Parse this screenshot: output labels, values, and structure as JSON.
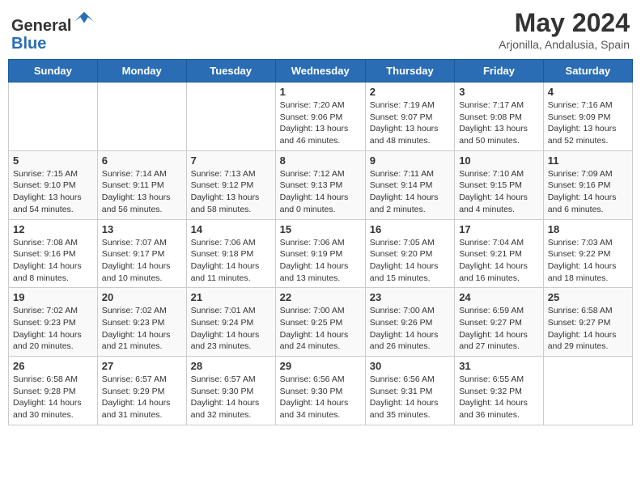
{
  "header": {
    "logo_line1": "General",
    "logo_line2": "Blue",
    "month_year": "May 2024",
    "location": "Arjonilla, Andalusia, Spain"
  },
  "days_of_week": [
    "Sunday",
    "Monday",
    "Tuesday",
    "Wednesday",
    "Thursday",
    "Friday",
    "Saturday"
  ],
  "weeks": [
    [
      {
        "day": "",
        "info": ""
      },
      {
        "day": "",
        "info": ""
      },
      {
        "day": "",
        "info": ""
      },
      {
        "day": "1",
        "info": "Sunrise: 7:20 AM\nSunset: 9:06 PM\nDaylight: 13 hours\nand 46 minutes."
      },
      {
        "day": "2",
        "info": "Sunrise: 7:19 AM\nSunset: 9:07 PM\nDaylight: 13 hours\nand 48 minutes."
      },
      {
        "day": "3",
        "info": "Sunrise: 7:17 AM\nSunset: 9:08 PM\nDaylight: 13 hours\nand 50 minutes."
      },
      {
        "day": "4",
        "info": "Sunrise: 7:16 AM\nSunset: 9:09 PM\nDaylight: 13 hours\nand 52 minutes."
      }
    ],
    [
      {
        "day": "5",
        "info": "Sunrise: 7:15 AM\nSunset: 9:10 PM\nDaylight: 13 hours\nand 54 minutes."
      },
      {
        "day": "6",
        "info": "Sunrise: 7:14 AM\nSunset: 9:11 PM\nDaylight: 13 hours\nand 56 minutes."
      },
      {
        "day": "7",
        "info": "Sunrise: 7:13 AM\nSunset: 9:12 PM\nDaylight: 13 hours\nand 58 minutes."
      },
      {
        "day": "8",
        "info": "Sunrise: 7:12 AM\nSunset: 9:13 PM\nDaylight: 14 hours\nand 0 minutes."
      },
      {
        "day": "9",
        "info": "Sunrise: 7:11 AM\nSunset: 9:14 PM\nDaylight: 14 hours\nand 2 minutes."
      },
      {
        "day": "10",
        "info": "Sunrise: 7:10 AM\nSunset: 9:15 PM\nDaylight: 14 hours\nand 4 minutes."
      },
      {
        "day": "11",
        "info": "Sunrise: 7:09 AM\nSunset: 9:16 PM\nDaylight: 14 hours\nand 6 minutes."
      }
    ],
    [
      {
        "day": "12",
        "info": "Sunrise: 7:08 AM\nSunset: 9:16 PM\nDaylight: 14 hours\nand 8 minutes."
      },
      {
        "day": "13",
        "info": "Sunrise: 7:07 AM\nSunset: 9:17 PM\nDaylight: 14 hours\nand 10 minutes."
      },
      {
        "day": "14",
        "info": "Sunrise: 7:06 AM\nSunset: 9:18 PM\nDaylight: 14 hours\nand 11 minutes."
      },
      {
        "day": "15",
        "info": "Sunrise: 7:06 AM\nSunset: 9:19 PM\nDaylight: 14 hours\nand 13 minutes."
      },
      {
        "day": "16",
        "info": "Sunrise: 7:05 AM\nSunset: 9:20 PM\nDaylight: 14 hours\nand 15 minutes."
      },
      {
        "day": "17",
        "info": "Sunrise: 7:04 AM\nSunset: 9:21 PM\nDaylight: 14 hours\nand 16 minutes."
      },
      {
        "day": "18",
        "info": "Sunrise: 7:03 AM\nSunset: 9:22 PM\nDaylight: 14 hours\nand 18 minutes."
      }
    ],
    [
      {
        "day": "19",
        "info": "Sunrise: 7:02 AM\nSunset: 9:23 PM\nDaylight: 14 hours\nand 20 minutes."
      },
      {
        "day": "20",
        "info": "Sunrise: 7:02 AM\nSunset: 9:23 PM\nDaylight: 14 hours\nand 21 minutes."
      },
      {
        "day": "21",
        "info": "Sunrise: 7:01 AM\nSunset: 9:24 PM\nDaylight: 14 hours\nand 23 minutes."
      },
      {
        "day": "22",
        "info": "Sunrise: 7:00 AM\nSunset: 9:25 PM\nDaylight: 14 hours\nand 24 minutes."
      },
      {
        "day": "23",
        "info": "Sunrise: 7:00 AM\nSunset: 9:26 PM\nDaylight: 14 hours\nand 26 minutes."
      },
      {
        "day": "24",
        "info": "Sunrise: 6:59 AM\nSunset: 9:27 PM\nDaylight: 14 hours\nand 27 minutes."
      },
      {
        "day": "25",
        "info": "Sunrise: 6:58 AM\nSunset: 9:27 PM\nDaylight: 14 hours\nand 29 minutes."
      }
    ],
    [
      {
        "day": "26",
        "info": "Sunrise: 6:58 AM\nSunset: 9:28 PM\nDaylight: 14 hours\nand 30 minutes."
      },
      {
        "day": "27",
        "info": "Sunrise: 6:57 AM\nSunset: 9:29 PM\nDaylight: 14 hours\nand 31 minutes."
      },
      {
        "day": "28",
        "info": "Sunrise: 6:57 AM\nSunset: 9:30 PM\nDaylight: 14 hours\nand 32 minutes."
      },
      {
        "day": "29",
        "info": "Sunrise: 6:56 AM\nSunset: 9:30 PM\nDaylight: 14 hours\nand 34 minutes."
      },
      {
        "day": "30",
        "info": "Sunrise: 6:56 AM\nSunset: 9:31 PM\nDaylight: 14 hours\nand 35 minutes."
      },
      {
        "day": "31",
        "info": "Sunrise: 6:55 AM\nSunset: 9:32 PM\nDaylight: 14 hours\nand 36 minutes."
      },
      {
        "day": "",
        "info": ""
      }
    ]
  ]
}
